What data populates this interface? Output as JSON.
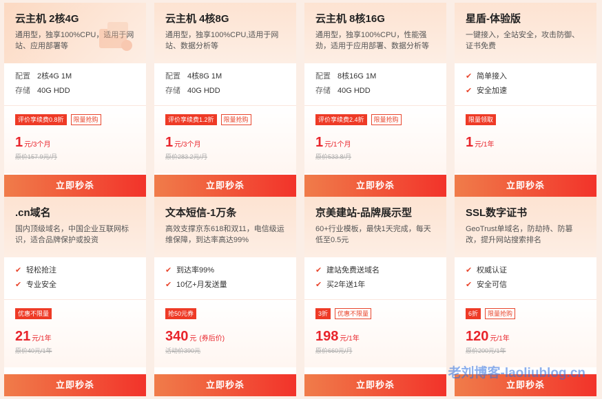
{
  "btn_label": "立即秒杀",
  "watermark": "老刘博客-laoliublog.cn",
  "cards": [
    {
      "title": "云主机 2核4G",
      "desc": "通用型，独享100%CPU，适用于网站、应用部署等",
      "specs": [
        {
          "k": "配置",
          "v": "2核4G 1M"
        },
        {
          "k": "存储",
          "v": "40G HDD"
        }
      ],
      "tags": [
        {
          "text": "评价享续费0.8折",
          "solid": true
        },
        {
          "text": "限量抢购",
          "solid": false
        }
      ],
      "price": "1",
      "unit": "元/3个月",
      "orig": "原价157.9元/月"
    },
    {
      "title": "云主机 4核8G",
      "desc": "通用型，独享100%CPU,适用于网站、数据分析等",
      "specs": [
        {
          "k": "配置",
          "v": "4核8G 1M"
        },
        {
          "k": "存储",
          "v": "40G HDD"
        }
      ],
      "tags": [
        {
          "text": "评价享续费1.2折",
          "solid": true
        },
        {
          "text": "限量抢购",
          "solid": false
        }
      ],
      "price": "1",
      "unit": "元/3个月",
      "orig": "原价283.2元/月"
    },
    {
      "title": "云主机 8核16G",
      "desc": "通用型，独享100%CPU，性能强劲，适用于应用部署、数据分析等",
      "specs": [
        {
          "k": "配置",
          "v": "8核16G 1M"
        },
        {
          "k": "存储",
          "v": "40G HDD"
        }
      ],
      "tags": [
        {
          "text": "评价享续费2.4折",
          "solid": true
        },
        {
          "text": "限量抢购",
          "solid": false
        }
      ],
      "price": "1",
      "unit": "元/1个月",
      "orig": "原价533.8/月"
    },
    {
      "title": "星盾-体验版",
      "desc": "一键接入，全站安全，攻击防御、证书免费",
      "checks": [
        "简单接入",
        "安全加速"
      ],
      "tags": [
        {
          "text": "限量领取",
          "solid": true
        }
      ],
      "price": "1",
      "unit": "元/1年",
      "orig": ""
    },
    {
      "title": ".cn域名",
      "desc": "国内顶级域名，中国企业互联网标识，适合品牌保护或投资",
      "checks": [
        "轻松抢注",
        "专业安全"
      ],
      "tags": [
        {
          "text": "优惠不限量",
          "solid": true
        }
      ],
      "price": "21",
      "unit": "元/1年",
      "orig": "原价40元/1年"
    },
    {
      "title": "文本短信-1万条",
      "desc": "高效支撑京东618和双11，电信级运维保障，到达率高达99%",
      "checks": [
        "到达率99%",
        "10亿+月发送量"
      ],
      "tags": [
        {
          "text": "抢50元券",
          "solid": true
        }
      ],
      "price": "340",
      "unit": "元",
      "unit2": "(券后价)",
      "orig": "活动价390元"
    },
    {
      "title": "京美建站-品牌展示型",
      "desc": "60+行业模板，最快1天完成，每天低至0.5元",
      "checks": [
        "建站免费送域名",
        "买2年送1年"
      ],
      "tags": [
        {
          "text": "3折",
          "solid": true
        },
        {
          "text": "优惠不限量",
          "solid": false
        }
      ],
      "price": "198",
      "unit": "元/1年",
      "orig": "原价660元/月"
    },
    {
      "title": "SSL数字证书",
      "desc": "GeoTrust单域名，防劫持、防篡改，提升网站搜索排名",
      "checks": [
        "权威认证",
        "安全可信"
      ],
      "tags": [
        {
          "text": "6折",
          "solid": true
        },
        {
          "text": "限量抢购",
          "solid": false
        }
      ],
      "price": "120",
      "unit": "元/1年",
      "orig": "原价200元/1年"
    }
  ]
}
